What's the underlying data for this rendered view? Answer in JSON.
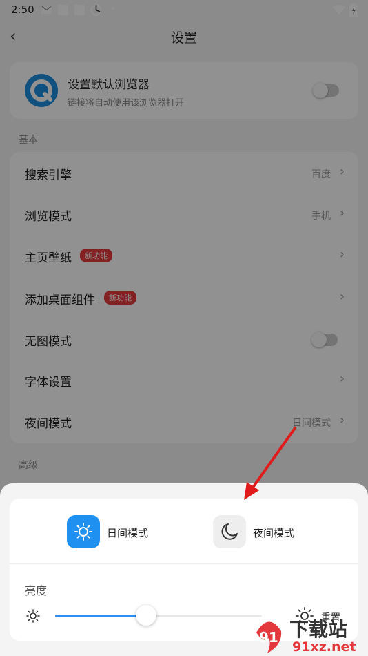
{
  "status_bar": {
    "time": "2:50",
    "dot": "•"
  },
  "nav": {
    "title": "设置",
    "back_icon": "‹"
  },
  "default_browser": {
    "title": "设置默认浏览器",
    "subtitle": "链接将自动使用该浏览器打开",
    "enabled": false
  },
  "basic": {
    "section": "基本",
    "items": [
      {
        "label": "搜索引擎",
        "value": "百度"
      },
      {
        "label": "浏览模式",
        "value": "手机"
      },
      {
        "label": "主页壁纸",
        "badge": "新功能"
      },
      {
        "label": "添加桌面组件",
        "badge": "新功能"
      },
      {
        "label": "无图模式",
        "enabled": false
      },
      {
        "label": "字体设置"
      },
      {
        "label": "夜间模式",
        "value": "日间模式"
      }
    ]
  },
  "advanced": {
    "section": "高级"
  },
  "sheet": {
    "day_mode": "日间模式",
    "night_mode": "夜间模式",
    "brightness_label": "亮度",
    "brightness_value": 0.44,
    "reset_label": "重置"
  },
  "watermark": {
    "text": "下载站",
    "site": "91xz.net",
    "logo": "91"
  },
  "colors": {
    "accent": "#2b8ef0",
    "badge": "#e4393c",
    "arrow": "#e01b1b"
  }
}
